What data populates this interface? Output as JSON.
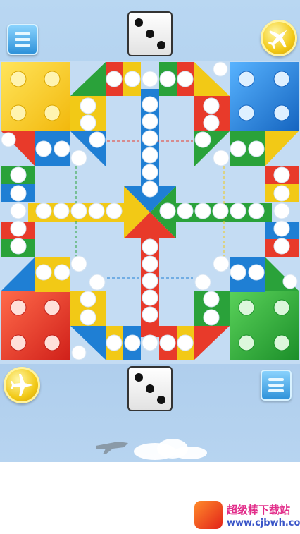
{
  "screen": {
    "name": "ludo-flight-chess-board",
    "players": [
      {
        "color": "yellow",
        "hex": "#f2c916",
        "base": "top-left"
      },
      {
        "color": "blue",
        "hex": "#1f7fd4",
        "base": "top-right"
      },
      {
        "color": "red",
        "hex": "#e83a2a",
        "base": "bottom-left"
      },
      {
        "color": "green",
        "hex": "#2aa23a",
        "base": "bottom-right"
      }
    ]
  },
  "controls": {
    "top_menu_icon": "menu-icon",
    "top_coin_icon": "airplane-coin-icon",
    "top_dice_value": 3,
    "bottom_menu_icon": "menu-icon",
    "bottom_coin_icon": "airplane-coin-icon",
    "bottom_dice_value": 3
  },
  "watermark": {
    "site_name": "超级棒下载站",
    "site_url": "www.cjbwh.com"
  }
}
